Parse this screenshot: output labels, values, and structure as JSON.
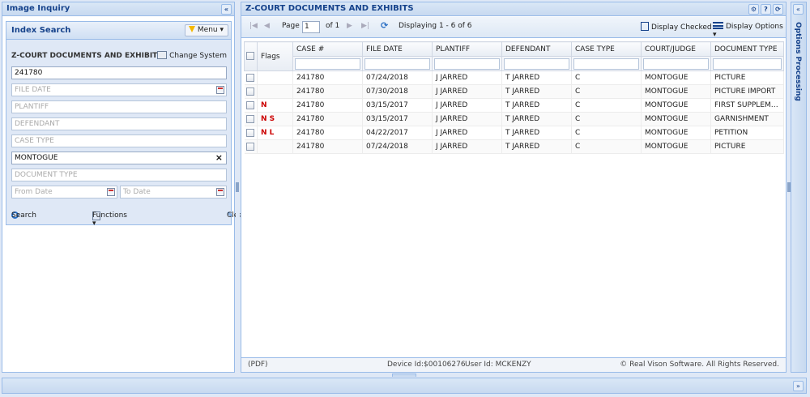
{
  "left_panel": {
    "title": "Image Inquiry",
    "collapse": "«",
    "search": {
      "title": "Index Search",
      "menu_label": "Menu ▾",
      "system_name": "Z-COURT DOCUMENTS AND EXHIBITS",
      "change_system": "Change System",
      "case_number": "241780",
      "file_date_placeholder": "FILE DATE",
      "plaintiff_placeholder": "PLANTIFF",
      "defendant_placeholder": "DEFENDANT",
      "case_type_placeholder": "CASE TYPE",
      "court_judge": "MONTOGUE",
      "clear_x": "×",
      "document_type_placeholder": "DOCUMENT TYPE",
      "from_date_placeholder": "From Date",
      "to_date_placeholder": "To Date",
      "search_label": "Search",
      "functions_label": "Functions ▾",
      "clear_label": "Clear"
    }
  },
  "grid_panel": {
    "title": "Z-COURT DOCUMENTS AND EXHIBITS",
    "tools": [
      "⚙",
      "?",
      "⟳"
    ],
    "toolbar": {
      "first": "|◀",
      "prev": "◀",
      "page_label": "Page",
      "page_value": "1",
      "of_label": "of 1",
      "next": "▶",
      "last": "▶|",
      "refresh": "⟳",
      "displaying": "Displaying 1 - 6 of 6",
      "display_checked": "Display Checked",
      "display_options": "Display Options ▾"
    },
    "columns": [
      "Flags",
      "CASE #",
      "FILE DATE",
      "PLANTIFF",
      "DEFENDANT",
      "CASE TYPE",
      "COURT/JUDGE",
      "DOCUMENT TYPE"
    ],
    "rows": [
      {
        "flags": "",
        "case": "241780",
        "file_date": "07/24/2018",
        "plaintiff": "J JARRED",
        "defendant": "T JARRED",
        "case_type": "C",
        "court": "MONTOGUE",
        "doc_type": "PICTURE"
      },
      {
        "flags": "",
        "case": "241780",
        "file_date": "07/30/2018",
        "plaintiff": "J JARRED",
        "defendant": "T JARRED",
        "case_type": "C",
        "court": "MONTOGUE",
        "doc_type": "PICTURE IMPORT"
      },
      {
        "flags": "N",
        "case": "241780",
        "file_date": "03/15/2017",
        "plaintiff": "J JARRED",
        "defendant": "T JARRED",
        "case_type": "C",
        "court": "MONTOGUE",
        "doc_type": "FIRST SUPPLEME..."
      },
      {
        "flags": "N S",
        "case": "241780",
        "file_date": "03/15/2017",
        "plaintiff": "J JARRED",
        "defendant": "T JARRED",
        "case_type": "C",
        "court": "MONTOGUE",
        "doc_type": "GARNISHMENT"
      },
      {
        "flags": "N L",
        "case": "241780",
        "file_date": "04/22/2017",
        "plaintiff": "J JARRED",
        "defendant": "T JARRED",
        "case_type": "C",
        "court": "MONTOGUE",
        "doc_type": "PETITION"
      },
      {
        "flags": "",
        "case": "241780",
        "file_date": "07/24/2018",
        "plaintiff": "J JARRED",
        "defendant": "T JARRED",
        "case_type": "C",
        "court": "MONTOGUE",
        "doc_type": "PICTURE"
      }
    ],
    "footer": {
      "pdf": "(PDF)",
      "device": "Device Id:$00106276",
      "user": "User Id: MCKENZY",
      "copyright": "© Real Vison Software. All Rights Reserved."
    }
  },
  "side_panel": {
    "collapse": "«",
    "title": "Options Processing"
  },
  "bottom_panel": {
    "expand": "»"
  },
  "colors": {
    "header_text": "#15428b",
    "border": "#99bbe8",
    "flag": "#cc0000"
  }
}
